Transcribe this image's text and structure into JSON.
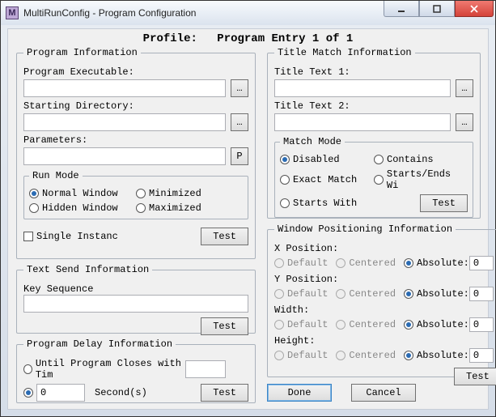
{
  "window": {
    "title": "MultiRunConfig - Program Configuration",
    "app_icon_letter": "M"
  },
  "profile": {
    "label": "Profile:",
    "value": "Program Entry 1 of 1"
  },
  "program_info": {
    "legend": "Program Information",
    "exe_label": "Program Executable:",
    "exe_value": "",
    "exe_browse": "…",
    "dir_label": "Starting Directory:",
    "dir_value": "",
    "dir_browse": "…",
    "params_label": "Parameters:",
    "params_value": "",
    "params_btn": "P",
    "run_mode": {
      "legend": "Run Mode",
      "normal": "Normal Window",
      "minimized": "Minimized",
      "hidden": "Hidden Window",
      "maximized": "Maximized"
    },
    "single_instance": "Single Instanc",
    "test_btn": "Test"
  },
  "text_send": {
    "legend": "Text Send Information",
    "key_seq_label": "Key Sequence",
    "key_seq_value": "",
    "test_btn": "Test"
  },
  "delay": {
    "legend": "Program Delay Information",
    "until_closes": "Until Program Closes with Tim",
    "until_value": "",
    "seconds_value": "0",
    "seconds_label": "Second(s)",
    "test_btn": "Test"
  },
  "title_match": {
    "legend": "Title Match Information",
    "t1_label": "Title Text 1:",
    "t1_value": "",
    "t1_browse": "…",
    "t2_label": "Title Text 2:",
    "t2_value": "",
    "t2_browse": "…",
    "match_mode": {
      "legend": "Match Mode",
      "disabled": "Disabled",
      "contains": "Contains",
      "exact": "Exact Match",
      "starts_ends": "Starts/Ends Wi",
      "starts_with": "Starts With",
      "test_btn": "Test"
    }
  },
  "positioning": {
    "legend": "Window Positioning Information",
    "xpos_label": "X Position:",
    "ypos_label": "Y Position:",
    "width_label": "Width:",
    "height_label": "Height:",
    "opt_default": "Default",
    "opt_centered": "Centered",
    "opt_absolute": "Absolute:",
    "x_abs": "0",
    "y_abs": "0",
    "w_abs": "0",
    "h_abs": "0",
    "test_btn": "Test"
  },
  "footer": {
    "done": "Done",
    "cancel": "Cancel"
  }
}
